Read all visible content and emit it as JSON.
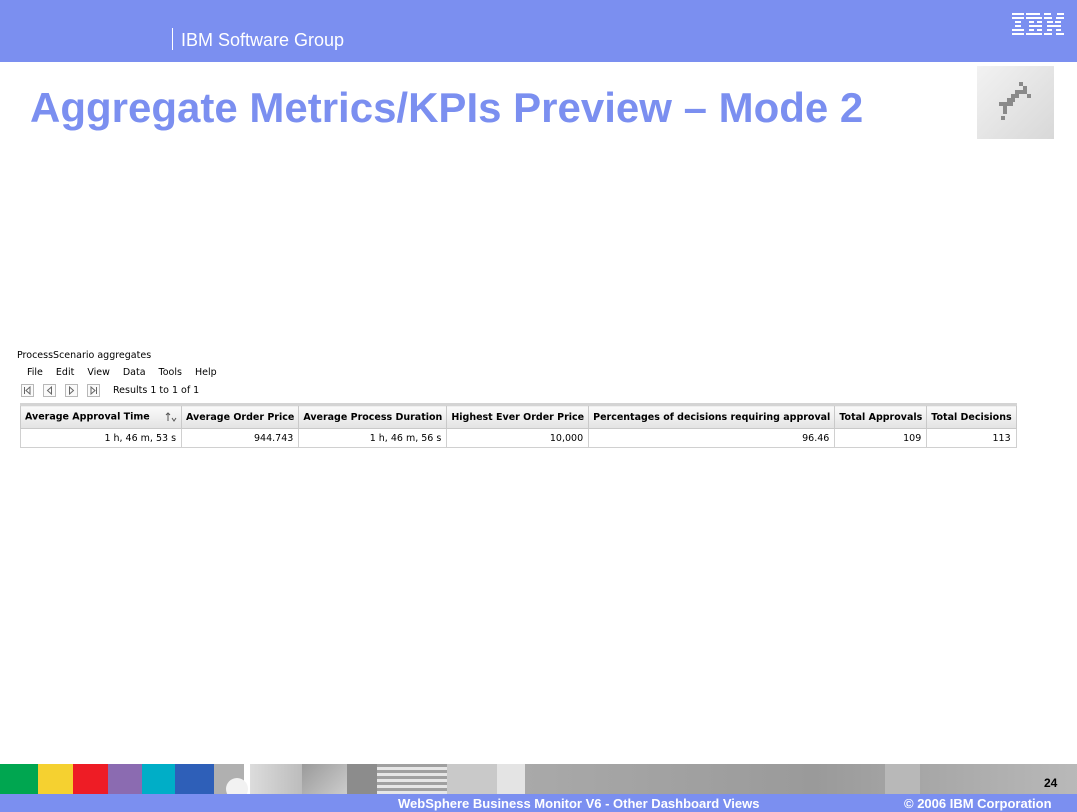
{
  "header": {
    "group_label": "IBM Software Group",
    "logo_text": "IBM",
    "title": "Aggregate Metrics/KPIs Preview – Mode 2"
  },
  "app": {
    "title": "ProcessScenario aggregates",
    "menu": [
      "File",
      "Edit",
      "View",
      "Data",
      "Tools",
      "Help"
    ],
    "pager": {
      "buttons": [
        "first-page-icon",
        "previous-page-icon",
        "next-page-icon",
        "last-page-icon"
      ],
      "results_text": "Results 1 to 1 of 1"
    },
    "table": {
      "columns": [
        "Average Approval Time",
        "Average Order Price",
        "Average Process Duration",
        "Highest Ever Order Price",
        "Percentages of decisions requiring approval",
        "Total Approvals",
        "Total Decisions"
      ],
      "rows": [
        [
          "1 h, 46 m, 53 s",
          "944.743",
          "1 h, 46 m, 56 s",
          "10,000",
          "96.46",
          "109",
          "113"
        ]
      ],
      "sorted_column_icon": "sort-ascending-icon"
    }
  },
  "footer": {
    "course_title": "WebSphere Business Monitor V6 - Other Dashboard Views",
    "copyright": "© 2006 IBM Corporation",
    "page_number": "24"
  },
  "colors": {
    "accent": "#7b8ff0",
    "strip_green": "#00a650",
    "strip_yellow": "#f5d130",
    "strip_red": "#ee1c25",
    "strip_purple": "#8b6bb1",
    "strip_teal": "#00aec7",
    "strip_blue": "#2e5fb8"
  }
}
